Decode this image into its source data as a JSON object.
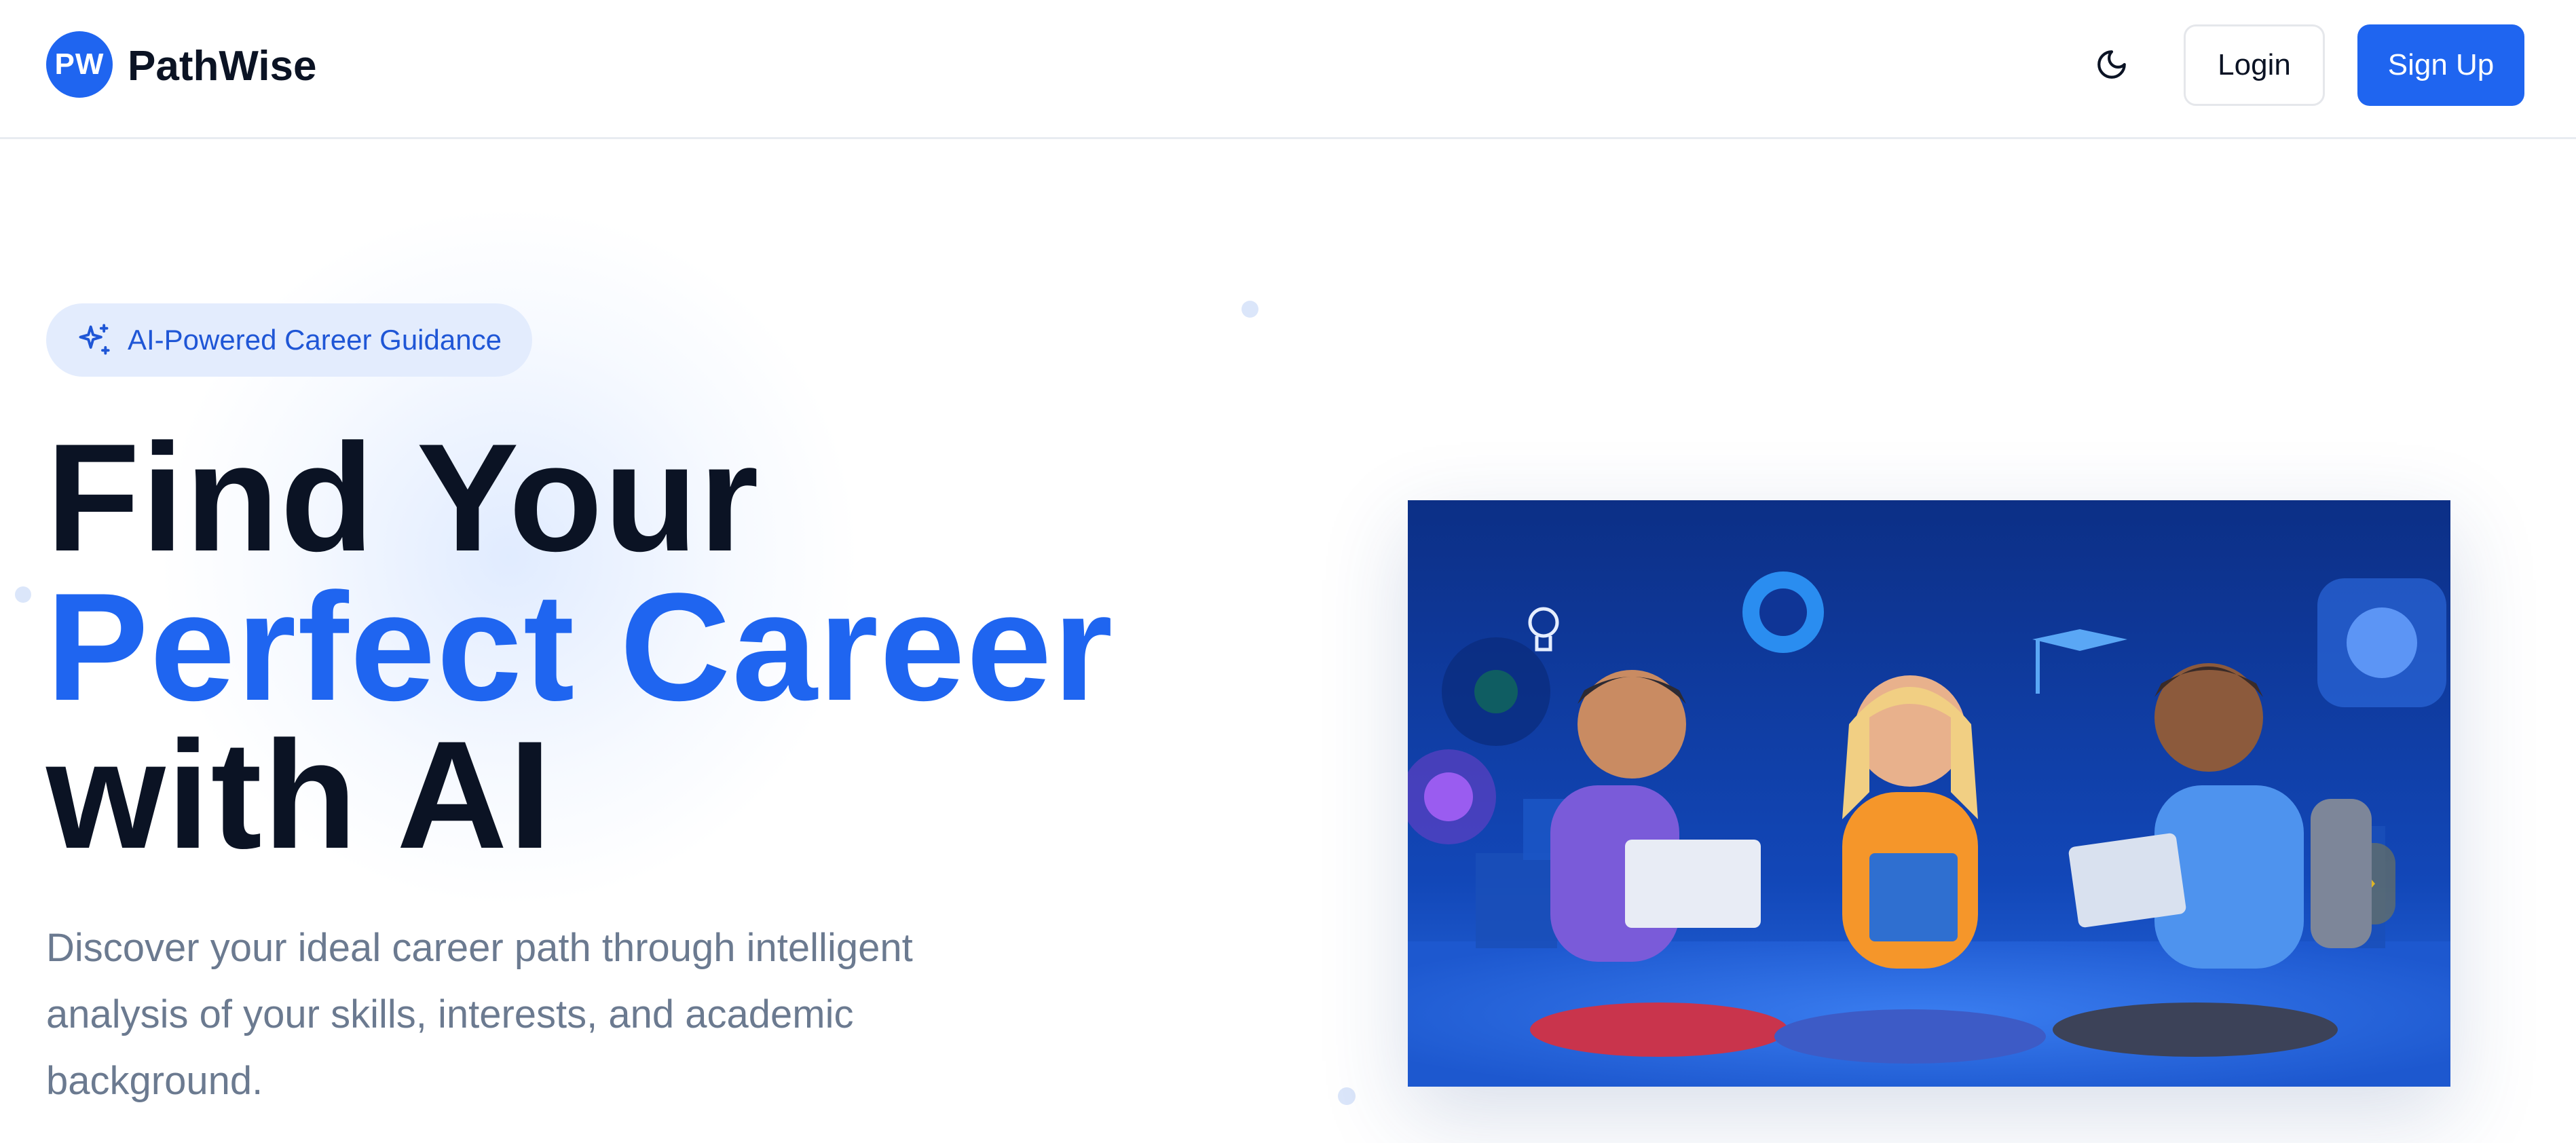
{
  "header": {
    "logo_initials": "PW",
    "brand_name": "PathWise",
    "theme_toggle_icon": "moon-icon",
    "login_label": "Login",
    "signup_label": "Sign Up"
  },
  "hero": {
    "badge_icon": "sparkles-icon",
    "badge_text": "AI-Powered Career Guidance",
    "title_line1": "Find Your",
    "title_line2": "Perfect Career",
    "title_line3": "with AI",
    "description": "Discover your ideal career path through intelligent analysis of your skills, interests, and academic background.",
    "illustration_subject": "three students sitting on the floor with laptop, books and tablet surrounded by learning icons"
  },
  "colors": {
    "primary": "#1f65f0",
    "heading": "#0b1324",
    "muted_text": "#6b7a90",
    "badge_bg": "#e3ecfd",
    "badge_text": "#1f56d6",
    "illustration_bg": "#0d3a9a"
  }
}
